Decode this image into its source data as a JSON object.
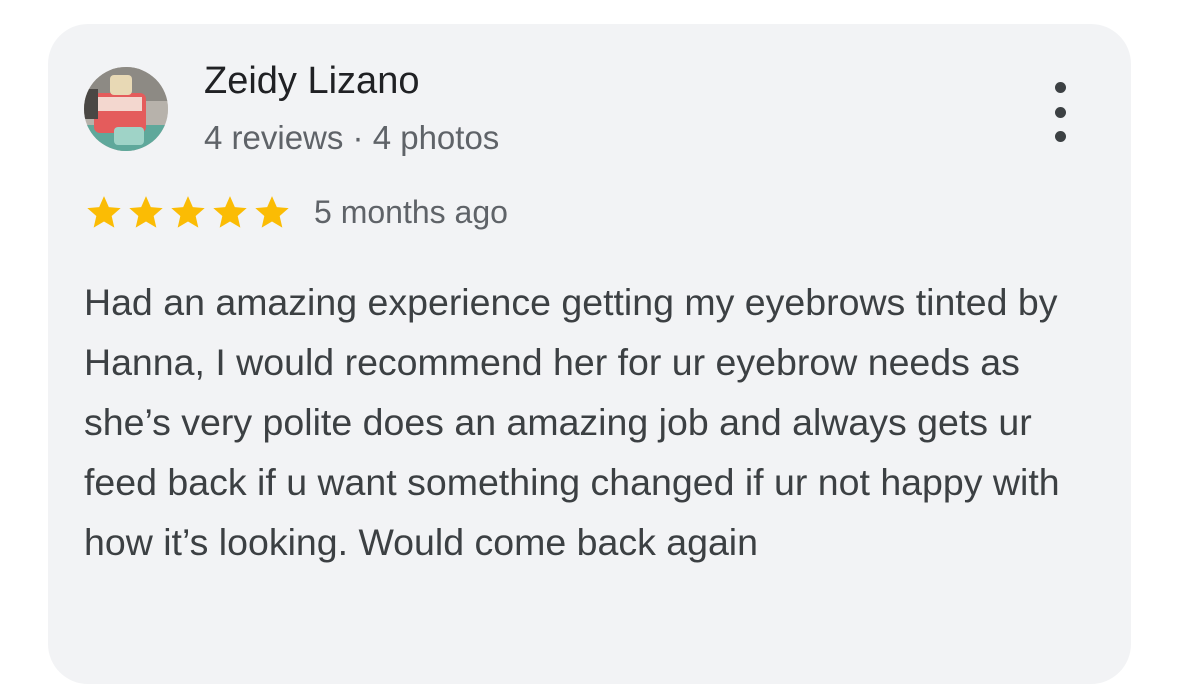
{
  "review": {
    "reviewer_name": "Zeidy Lizano",
    "reviewer_meta": "4 reviews · 4 photos",
    "rating": 5,
    "rating_max": 5,
    "star_color": "#fbbc04",
    "date": "5 months ago",
    "text": "Had an amazing experience getting my eyebrows tinted by Hanna, I would recommend her for ur eyebrow needs as she’s very polite does an amazing job and always gets ur feed back if u want something changed if ur not happy with how it’s looking. Would come back again",
    "avatar_icon": "profile-photo",
    "menu_icon": "more-vert-icon"
  }
}
